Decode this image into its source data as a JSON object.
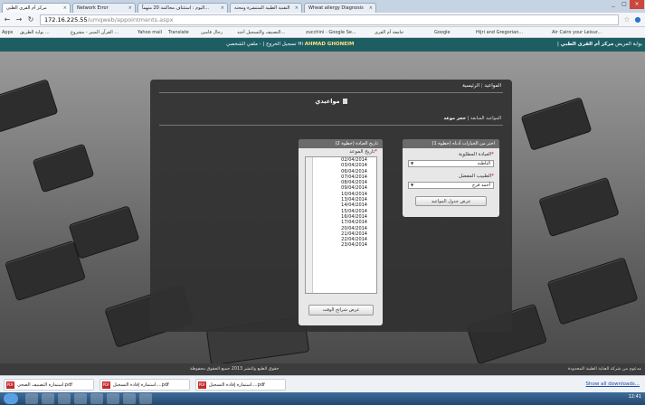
{
  "browser": {
    "tabs": [
      {
        "label": "مركز أم القرى الطبي"
      },
      {
        "label": "Network Error"
      },
      {
        "label": "اليوم : استئناف محاكمة 20 متهماً..."
      },
      {
        "label": "التقنية الطبية المنتشرة ومحنة"
      },
      {
        "label": "Wheat allergy Diagnosis"
      }
    ],
    "address": {
      "host": "172.16.225.55",
      "path": "/umqweb/appointments.aspx"
    },
    "bookmarks": [
      {
        "label": "Apps"
      },
      {
        "label": "بوابة الطريق ..."
      },
      {
        "label": "القرآن المنير - مشروع ..."
      },
      {
        "label": "Yahoo mail"
      },
      {
        "label": "Translate"
      },
      {
        "label": "رجال قامين"
      },
      {
        "label": "التصنيف والتسجيل أجند..."
      },
      {
        "label": "zucchini - Google Se..."
      },
      {
        "label": "جامعة أم القرى"
      },
      {
        "label": "Google"
      },
      {
        "label": "Hijri and Gregorian..."
      },
      {
        "label": "Air Cairo your Leisur..."
      }
    ]
  },
  "site": {
    "brand": "مركز أم القرى الطبي",
    "brand_sub": "| بوابة المريض",
    "user_greeting": "Hi",
    "user_name": "AHMAD GHONEIM",
    "user_sub": "- ملفي الشخصي",
    "logout": "تسجيل الخروج"
  },
  "breadcrumb": {
    "home": "الرئيسية",
    "sep": "|",
    "current": "المواعيد"
  },
  "page": {
    "title": "مواعيدي",
    "sub_tabs": {
      "active": "حجز موعد",
      "sep": "|",
      "other": "المواعيد السابقة"
    }
  },
  "step1": {
    "title": "اختر من الخيارات أدناه (خطوة 1)",
    "clinic_label": "العيادة المطلوبة",
    "clinic_value": "الباطنة",
    "doctor_label": "الطبيب المفضل",
    "doctor_value": "أحمد فرج",
    "button": "عرض جدول المواعيد"
  },
  "step2": {
    "title": "تاريخ العيادة (خطوة 2)",
    "date_label": "تاريخ الموعد",
    "dates": [
      "02/04/2014",
      "03/04/2014",
      "06/04/2014",
      "07/04/2014",
      "08/04/2014",
      "09/04/2014",
      "10/04/2014",
      "13/04/2014",
      "14/04/2014",
      "15/04/2014",
      "16/04/2014",
      "17/04/2014",
      "20/04/2014",
      "21/04/2014",
      "22/04/2014",
      "23/04/2014"
    ],
    "button": "عرض شرائح الوقت"
  },
  "footer": {
    "copyright": "حقوق الطبع والنشر 2013 جميع الحقوق محفوظة",
    "powered": "مدعوم من شركة العناية الطبية المحدودة"
  },
  "downloads": {
    "items": [
      {
        "label": "استمارة التصنيف الصحي.pdf"
      },
      {
        "label": "استمارة إفادة التسجيل....pdf"
      },
      {
        "label": "استمارة إفادة التسجيل....pdf"
      }
    ],
    "show_all": "Show all downloads..."
  },
  "taskbar": {
    "clock": "12:41"
  }
}
